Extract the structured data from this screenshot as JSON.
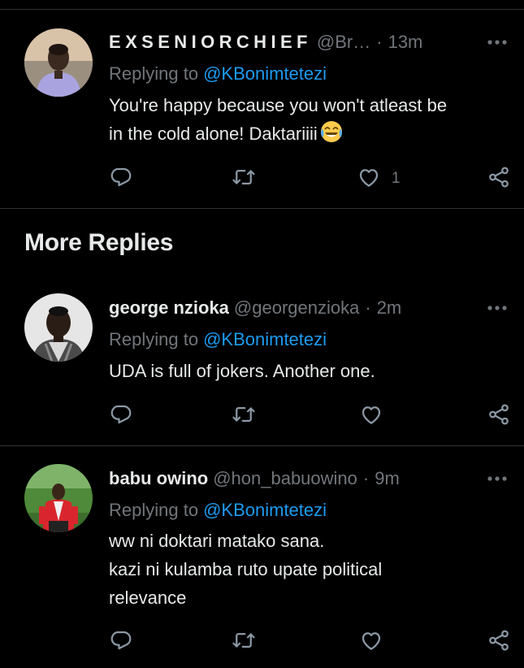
{
  "tweets": [
    {
      "display_name": "EXSENIORCHIEF",
      "handle": "@Br…",
      "separator": "·",
      "time": "13m",
      "replying_label": "Replying to",
      "replying_to": "@KBonimtetezi",
      "lines": [
        "You're happy because you won't atleast be",
        "in the cold alone! Daktariiii"
      ],
      "emoji": "face-with-tears-of-joy",
      "like_count": "1"
    },
    {
      "display_name": "george nzioka",
      "handle": "@georgenzioka",
      "separator": "·",
      "time": "2m",
      "replying_label": "Replying to",
      "replying_to": "@KBonimtetezi",
      "lines": [
        "UDA is full of jokers. Another one."
      ]
    },
    {
      "display_name": "babu owino",
      "handle": "@hon_babuowino",
      "separator": "·",
      "time": "9m",
      "replying_label": "Replying to",
      "replying_to": "@KBonimtetezi",
      "lines": [
        "ww ni doktari matako sana.",
        "kazi ni kulamba ruto upate political",
        "relevance"
      ]
    }
  ],
  "section": {
    "title": "More Replies"
  },
  "colors": {
    "background": "#000000",
    "text": "#e7e9ea",
    "secondary": "#71767b",
    "accent": "#1d9bf0",
    "divider": "#2f3336"
  },
  "icons": [
    "more-icon",
    "reply-icon",
    "retweet-icon",
    "like-icon",
    "share-icon"
  ]
}
